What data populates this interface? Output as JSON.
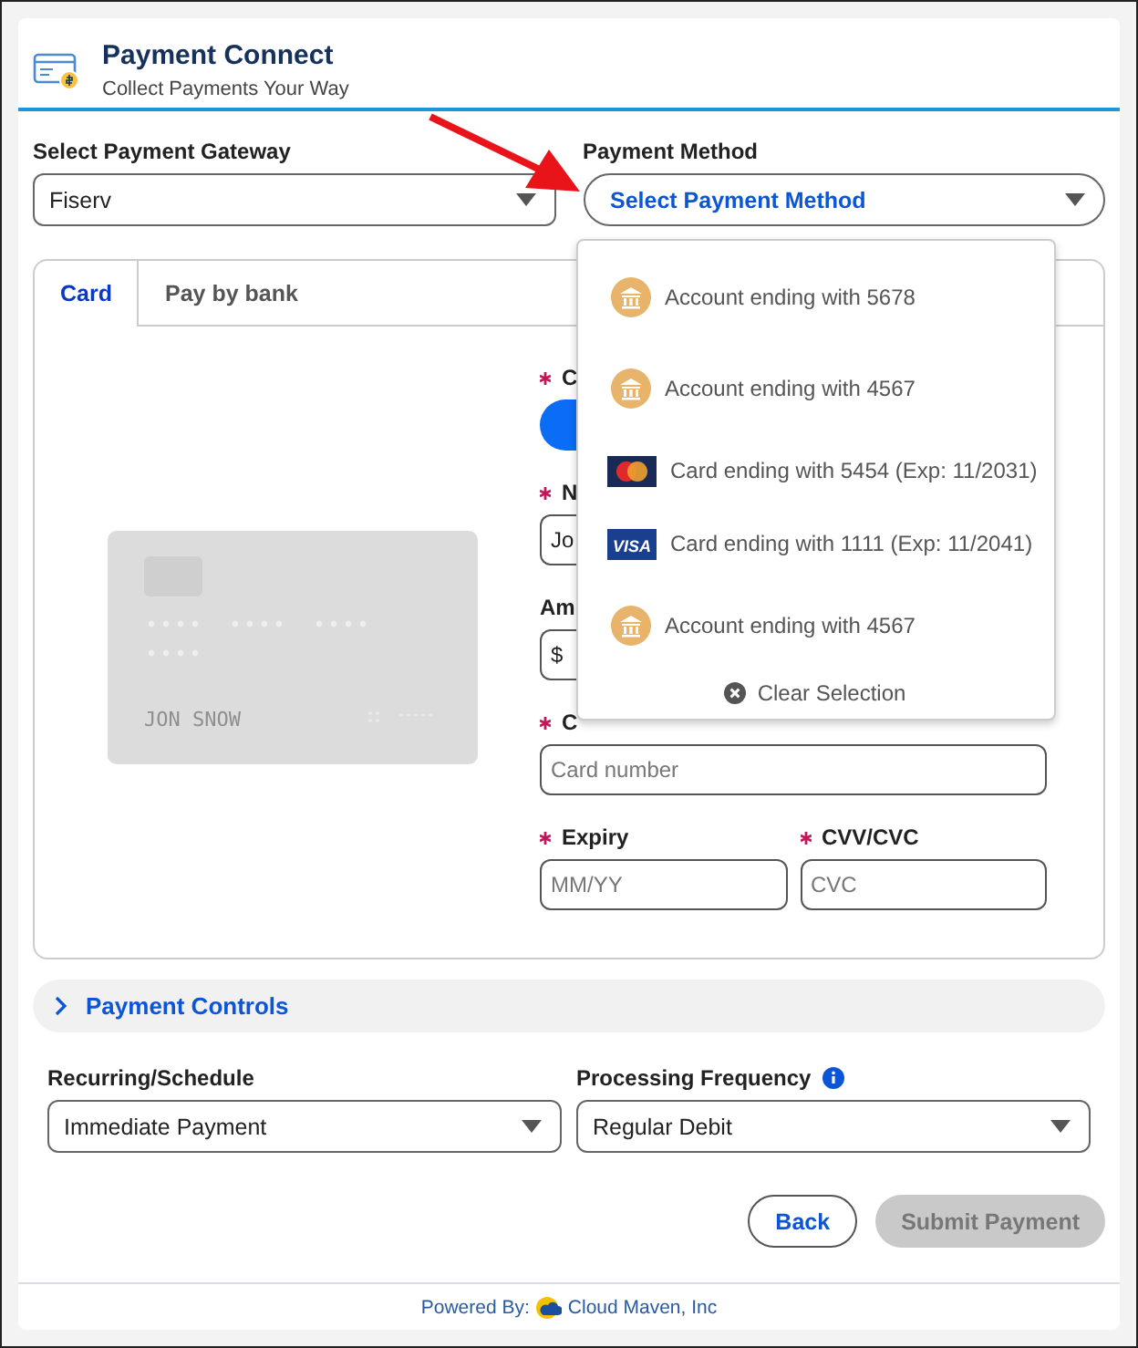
{
  "header": {
    "title": "Payment Connect",
    "subtitle": "Collect Payments Your Way"
  },
  "gateway": {
    "label": "Select Payment Gateway",
    "value": "Fiserv"
  },
  "payment_method": {
    "label": "Payment Method",
    "value": "Select Payment Method",
    "expanded": true
  },
  "dropdown": {
    "items": [
      {
        "kind": "bank",
        "label": "Account ending with 5678"
      },
      {
        "kind": "bank",
        "label": "Account ending with 4567"
      },
      {
        "kind": "mastercard",
        "label": "Card ending with 5454 (Exp: 11/2031)"
      },
      {
        "kind": "visa",
        "label": "Card ending with 1111 (Exp: 11/2041)",
        "logo_text": "VISA"
      },
      {
        "kind": "bank",
        "label": "Account ending with 4567"
      }
    ],
    "clear": "Clear Selection"
  },
  "tabs": [
    {
      "label": "Card",
      "selected": true
    },
    {
      "label": "Pay by bank",
      "selected": false
    }
  ],
  "card_preview": {
    "name": "JON SNOW"
  },
  "form": {
    "fields": [
      {
        "kind": "toggle",
        "label": "C",
        "required": true,
        "on": true
      },
      {
        "kind": "input",
        "label": "N",
        "required": true,
        "value": "Jo"
      },
      {
        "kind": "input",
        "label": "Am",
        "required": false,
        "value": "$"
      },
      {
        "kind": "input",
        "label": "C",
        "required": true,
        "placeholder": "Card number"
      }
    ],
    "pair": [
      {
        "label": "Expiry",
        "required": true,
        "placeholder": "MM/YY"
      },
      {
        "label": "CVV/CVC",
        "required": true,
        "placeholder": "CVC"
      }
    ]
  },
  "accordion": {
    "label": "Payment Controls",
    "expanded": false
  },
  "schedule": [
    {
      "label": "Recurring/Schedule",
      "value": "Immediate Payment",
      "info": false
    },
    {
      "label": "Processing Frequency",
      "value": "Regular Debit",
      "info": true
    }
  ],
  "buttons": [
    {
      "kind": "outline",
      "label": "Back",
      "disabled": false
    },
    {
      "kind": "brand",
      "label": "Submit Payment",
      "disabled": true
    }
  ],
  "footer": {
    "prefix": "Powered By:",
    "brand": "Cloud Maven, Inc"
  }
}
